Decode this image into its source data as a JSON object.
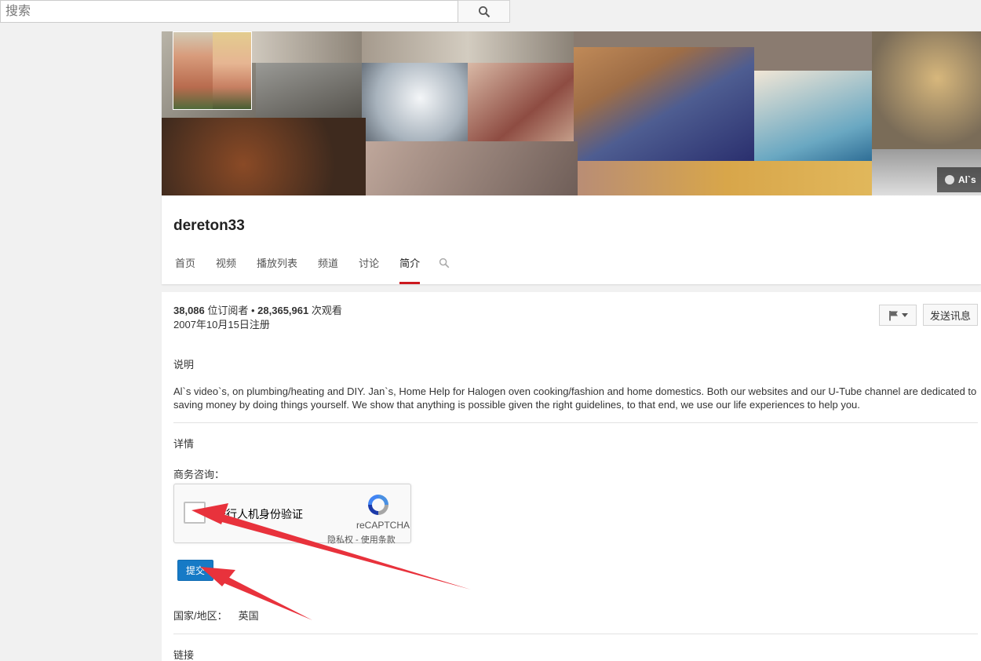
{
  "search": {
    "placeholder": "搜索",
    "value": ""
  },
  "banner": {
    "link_label": "Al`s"
  },
  "channel": {
    "name": "dereton33",
    "tabs": [
      {
        "label": "首页"
      },
      {
        "label": "视频"
      },
      {
        "label": "播放列表"
      },
      {
        "label": "频道"
      },
      {
        "label": "讨论"
      },
      {
        "label": "简介",
        "active": true
      }
    ]
  },
  "about": {
    "subscribers": "38,086",
    "subscribers_suffix": " 位订阅者 • ",
    "views": "28,365,961",
    "views_suffix": " 次观看",
    "joined": "2007年10月15日注册",
    "send_message_label": "发送讯息",
    "description_heading": "说明",
    "description": "Al`s video`s, on plumbing/heating and DIY. Jan`s, Home Help for Halogen oven cooking/fashion and home domestics. Both our websites and our U-Tube channel are dedicated to saving money by doing things yourself. We show that anything is possible given the right guidelines, to that end, we use our life experiences to help you.",
    "details_heading": "详情",
    "business_label": "商务咨询：",
    "recaptcha": {
      "label": "进行人机身份验证",
      "brand": "reCAPTCHA",
      "privacy": "隐私权",
      "separator": " - ",
      "terms": "使用条款"
    },
    "submit_label": "提交",
    "country_label": "国家/地区：",
    "country_value": "英国",
    "links_heading": "链接"
  },
  "colors": {
    "accent_red": "#cc181e",
    "submit_blue": "#167ac6",
    "annotation_arrow": "#e8323c"
  }
}
